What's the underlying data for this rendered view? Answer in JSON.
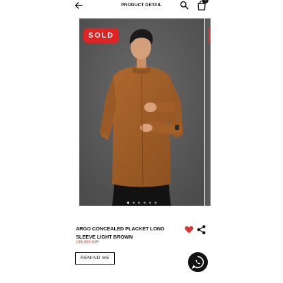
{
  "header": {
    "title": "PRODUCT DETAIL",
    "back_icon": "arrow-left-icon",
    "search_icon": "search-icon",
    "cart_icon": "shopping-bag-icon",
    "cart_count": "0"
  },
  "gallery": {
    "badge": "SOLD",
    "badge_color": "#e02424",
    "image_description_icon": "model-photo",
    "dots": 6,
    "active_dot": 0
  },
  "product": {
    "name": "ARGO CONCEALED PLACKET LONG SLEEVE LIGHT BROWN",
    "price": "185,000 IDR",
    "price_color": "#c0392b",
    "favorite_icon": "heart-icon",
    "favorite_color": "#e03131",
    "share_icon": "share-icon"
  },
  "actions": {
    "remind_label": "REMIND ME",
    "whatsapp_icon": "whatsapp-icon"
  }
}
